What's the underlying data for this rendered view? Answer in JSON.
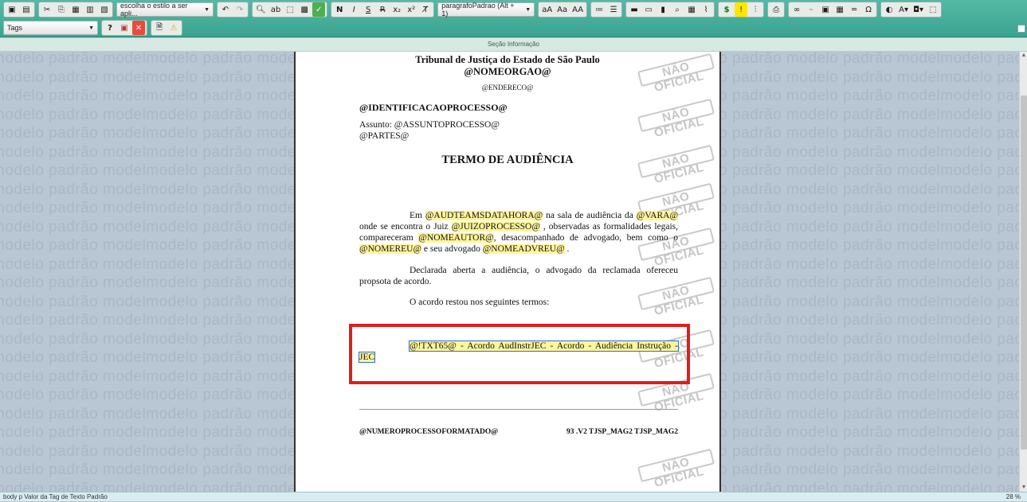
{
  "toolbar": {
    "style_select": "escolha o estilo a ser apli...",
    "paragraph_select": "paragrafoPadrao (Alt + 1)",
    "tags_select": "Tags",
    "help_label": "?"
  },
  "section_label": "Seção Informação",
  "watermark": {
    "line": "modelo padrão modelmodelo padrão modelo padrão modelmodelo padrão modelo padrão modelmodelo padrão modelo padrão modelmodelo padrão modelo padrão",
    "stamp": "NÃO OFICIAL"
  },
  "document": {
    "court": "Tribunal de Justiça do Estado de São Paulo",
    "org_tag": "@NOMEORGAO@",
    "address_tag": "@ENDERECO@",
    "process_id_tag": "@IDENTIFICACAOPROCESSO@",
    "subject_label": "Assunto:",
    "subject_tag": "@ASSUNTOPROCESSO@",
    "parties_tag": "@PARTES@",
    "title": "TERMO DE AUDIÊNCIA",
    "p1": {
      "t1": "Em",
      "tag1": "@AUDTEAMSDATAHORA@",
      "t2": "na sala de audiência da",
      "tag2": "@VARA@",
      "t3": "onde se encontra o Juiz",
      "tag3": "@JUIZOPROCESSO@",
      "t4": ", observadas as formalidades legais, compareceram",
      "tag4": "@NOMEAUTOR@",
      "t5": ", desacompanhado de advogado, bem como o",
      "tag5": "@NOMEREU@",
      "t6": "e seu advogado",
      "tag6": "@NOMEADVREU@",
      "t7": "."
    },
    "p2": "Declarada aberta a audiência, o advogado da reclamada ofereceu propsota de acordo.",
    "p3": "O acordo restou nos seguintes termos:",
    "selected_tag_line1": "@!TXT65@ - Acordo AudInstrJEC - Acordo - Audiência Instrução -",
    "selected_tag_line2": "JEC",
    "footer_left": "@NUMEROPROCESSOFORMATADO@",
    "footer_right": "93 .V2 TJSP_MAG2 TJSP_MAG2"
  },
  "statusbar": {
    "path": "body p Valor da Tag de Texto Padrão",
    "zoom": "28 %"
  },
  "colors": {
    "toolbar": "#3aa38f",
    "highlight": "#fff59a",
    "callout": "#e51b1b"
  }
}
